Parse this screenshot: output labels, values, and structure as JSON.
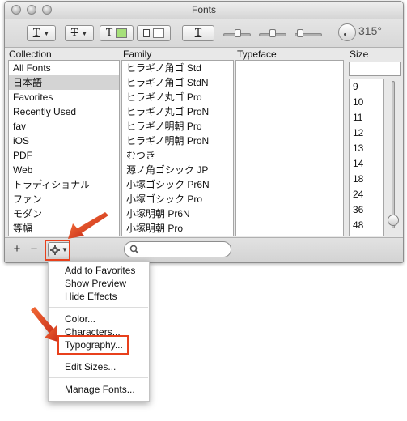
{
  "window": {
    "title": "Fonts"
  },
  "toolbar": {
    "underline_glyph": "T",
    "strike_glyph": "T",
    "text_color_glyph": "T",
    "doc_color_glyph": "",
    "shadow_glyph": "T",
    "angle": "315°"
  },
  "columns": {
    "collection": "Collection",
    "family": "Family",
    "typeface": "Typeface",
    "size": "Size"
  },
  "collections": [
    "All Fonts",
    "日本語",
    "Favorites",
    "Recently Used",
    "fav",
    "iOS",
    "PDF",
    "Web",
    "トラディショナル",
    "ファン",
    "モダン",
    "等幅"
  ],
  "families": [
    "ヒラギノ角ゴ Std",
    "ヒラギノ角ゴ StdN",
    "ヒラギノ丸ゴ Pro",
    "ヒラギノ丸ゴ ProN",
    "ヒラギノ明朝 Pro",
    "ヒラギノ明朝 ProN",
    "むつき",
    "源ノ角ゴシック JP",
    "小塚ゴシック Pr6N",
    "小塚ゴシック Pro",
    "小塚明朝 Pr6N",
    "小塚明朝 Pro"
  ],
  "sizes": [
    "9",
    "10",
    "11",
    "12",
    "13",
    "14",
    "18",
    "24",
    "36",
    "48"
  ],
  "bottom": {
    "add_label": "+",
    "remove_label": "−",
    "search_placeholder": ""
  },
  "menu": {
    "items": [
      "Add to Favorites",
      "Show Preview",
      "Hide Effects",
      "Color...",
      "Characters...",
      "Typography...",
      "Edit Sizes...",
      "Manage Fonts..."
    ]
  },
  "colors": {
    "highlight": "#e8401c",
    "text_color_swatch": "#a6e07a",
    "doc_color_swatch": "#ffffff",
    "selection": "#d4d4d4"
  }
}
